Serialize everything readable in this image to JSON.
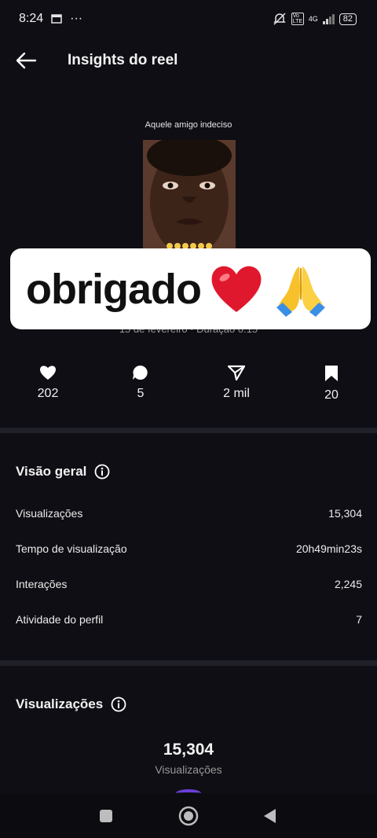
{
  "status_bar": {
    "time": "8:24",
    "dots": "···",
    "network": "4G",
    "volte": "Vo LTE",
    "battery": "82"
  },
  "app_bar": {
    "title": "Insights do reel"
  },
  "reel": {
    "caption": "Aquele amigo indeciso",
    "date_text": "15 de fevereiro · Duração 0:15"
  },
  "sticker": {
    "text": "obrigado",
    "emoji": [
      "red-heart",
      "folded-hands"
    ]
  },
  "stats": [
    {
      "icon": "heart-icon",
      "value": "202"
    },
    {
      "icon": "comment-icon",
      "value": "5"
    },
    {
      "icon": "share-icon",
      "value": "2 mil"
    },
    {
      "icon": "bookmark-icon",
      "value": "20"
    }
  ],
  "overview": {
    "title": "Visão geral",
    "rows": [
      {
        "label": "Visualizações",
        "value": "15,304"
      },
      {
        "label": "Tempo de visualização",
        "value": "20h49min23s"
      },
      {
        "label": "Interações",
        "value": "2,245"
      },
      {
        "label": "Atividade do perfil",
        "value": "7"
      }
    ]
  },
  "views": {
    "title": "Visualizações",
    "total": "15,304",
    "label": "Visualizações"
  },
  "colors": {
    "background": "#0e0e14",
    "divider": "#202029",
    "accent": "#6a3fd6"
  }
}
